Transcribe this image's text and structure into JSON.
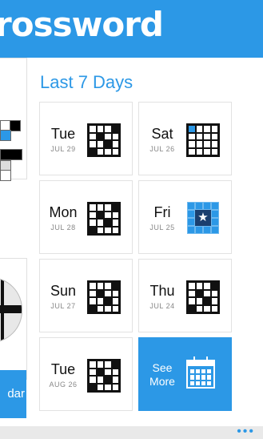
{
  "header": {
    "title": "rossword"
  },
  "left_pane": {
    "button_label": "dar"
  },
  "section": {
    "title": "Last 7 Days"
  },
  "tiles": [
    {
      "day": "Tue",
      "date": "JUL 29"
    },
    {
      "day": "Sat",
      "date": "JUL 26"
    },
    {
      "day": "Mon",
      "date": "JUL 28"
    },
    {
      "day": "Fri",
      "date": "JUL 25"
    },
    {
      "day": "Sun",
      "date": "JUL 27"
    },
    {
      "day": "Thu",
      "date": "JUL 24"
    },
    {
      "day": "Tue",
      "date": "AUG 26"
    }
  ],
  "see_more": {
    "label_line1": "See",
    "label_line2": "More"
  },
  "appbar": {
    "more": "•••"
  },
  "colors": {
    "accent": "#2c98e6",
    "text": "#111111",
    "muted": "#888888"
  }
}
